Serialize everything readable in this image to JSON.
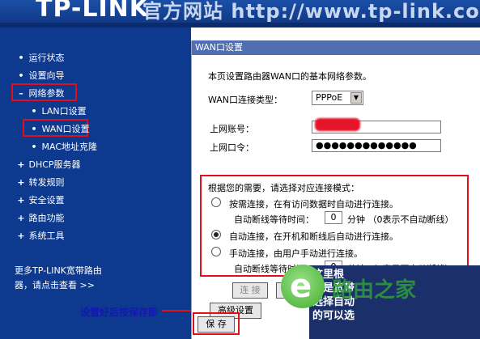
{
  "header": {
    "logo": "TP-LINK",
    "url_text": "官方网站 http://www.tp-link.com.cn"
  },
  "sidebar": {
    "items": [
      {
        "bullet": "•",
        "label": "运行状态"
      },
      {
        "bullet": "•",
        "label": "设置向导"
      },
      {
        "bullet": "–",
        "label": "网络参数"
      },
      {
        "bullet": "•",
        "label": "LAN口设置"
      },
      {
        "bullet": "•",
        "label": "WAN口设置"
      },
      {
        "bullet": "•",
        "label": "MAC地址克隆"
      },
      {
        "bullet": "+",
        "label": "DHCP服务器"
      },
      {
        "bullet": "+",
        "label": "转发规则"
      },
      {
        "bullet": "+",
        "label": "安全设置"
      },
      {
        "bullet": "+",
        "label": "路由功能"
      },
      {
        "bullet": "+",
        "label": "系统工具"
      }
    ],
    "more_line1": "更多TP-LINK宽带路由",
    "more_line2": "器，请点击查看 >>"
  },
  "panel": {
    "title": "WAN口设置",
    "intro": "本页设置路由器WAN口的基本网络参数。",
    "wan_type_label": "WAN口连接类型：",
    "wan_type_value": "PPPoE",
    "account_label": "上网账号：",
    "password_label": "上网口令：",
    "password_value": "●●●●●●●●●●●●●",
    "mode_heading": "根据您的需要，请选择对应连接模式：",
    "mode_on_demand": "按需连接，在有访问数据时自动进行连接。",
    "mode_auto": "自动连接，在开机和断线后自动进行连接。",
    "mode_manual": "手动连接，由用户手动进行连接。",
    "wait_label": "自动断线等待时间：",
    "wait_value": "0",
    "wait_unit": "分钟 （0表示不自动断线）",
    "connect_button": "连 接",
    "disconnect_button": "断 线",
    "advanced_button": "高级设置",
    "save_button": "保 存",
    "help_lines": [
      "这里根",
      "就是宽带",
      "选择自动",
      "的可以选"
    ]
  },
  "annotation": "设置好后按保存即",
  "watermark": {
    "letter": "e",
    "text": "路由之家"
  },
  "colors": {
    "sidebar_bg": "#0d3a8f",
    "panel_title_bg": "#4f6fb1",
    "highlight": "#e0101a"
  }
}
